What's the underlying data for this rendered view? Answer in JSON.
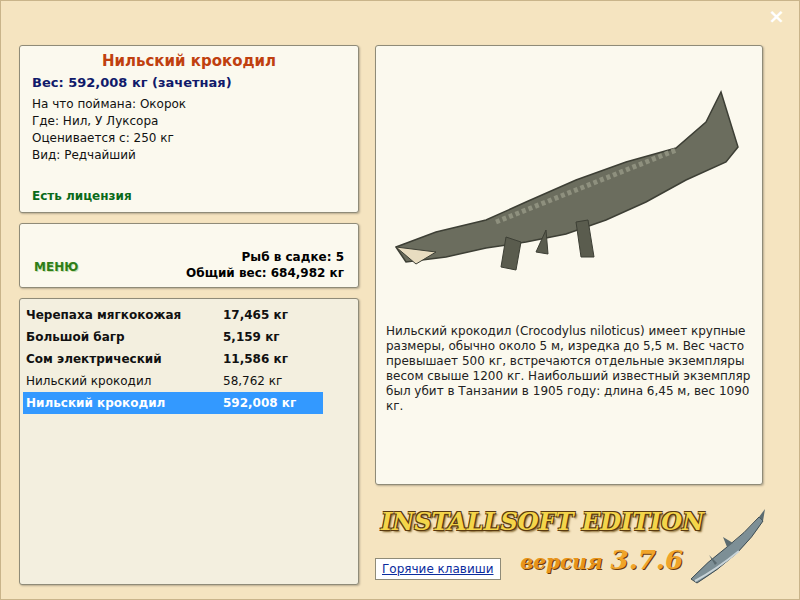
{
  "window": {
    "close": "×"
  },
  "catch": {
    "title": "Нильский крокодил",
    "weight": "Вес: 592,008 кг (зачетная)",
    "details": [
      "На что поймана: Окорок",
      "Где: Нил, У Луксора",
      "Оценивается с: 250 кг",
      "Вид: Редчайший"
    ],
    "license": "Есть лицензия"
  },
  "menu": {
    "label": "МЕНЮ",
    "count": "Рыб в садке: 5",
    "total": "Общий вес: 684,982 кг"
  },
  "fish_list": [
    {
      "name": "Черепаха мягкокожая",
      "weight": "17,465 кг",
      "trophy": true,
      "selected": false
    },
    {
      "name": "Большой багр",
      "weight": "5,159 кг",
      "trophy": true,
      "selected": false
    },
    {
      "name": "Сом электрический",
      "weight": "11,586 кг",
      "trophy": true,
      "selected": false
    },
    {
      "name": "Нильский крокодил",
      "weight": "58,762 кг",
      "trophy": false,
      "selected": false
    },
    {
      "name": "Нильский крокодил",
      "weight": "592,008 кг",
      "trophy": true,
      "selected": true
    }
  ],
  "description": "Нильский крокодил (Crocodylus niloticus) имеет крупные размеры, обычно около 5 м, изредка до 5,5 м. Вес часто превышает 500 кг, встречаются отдельные экземпляры весом свыше 1200 кг. Наибольший известный экземпляр был убит в Танзании в 1905 году: длина 6,45 м, вес 1090 кг.",
  "logo": {
    "title": "INSTALLSOFT EDITION",
    "version_label": "версия",
    "version": "3.7.6"
  },
  "hotkeys_button": "Горячие клавиши"
}
